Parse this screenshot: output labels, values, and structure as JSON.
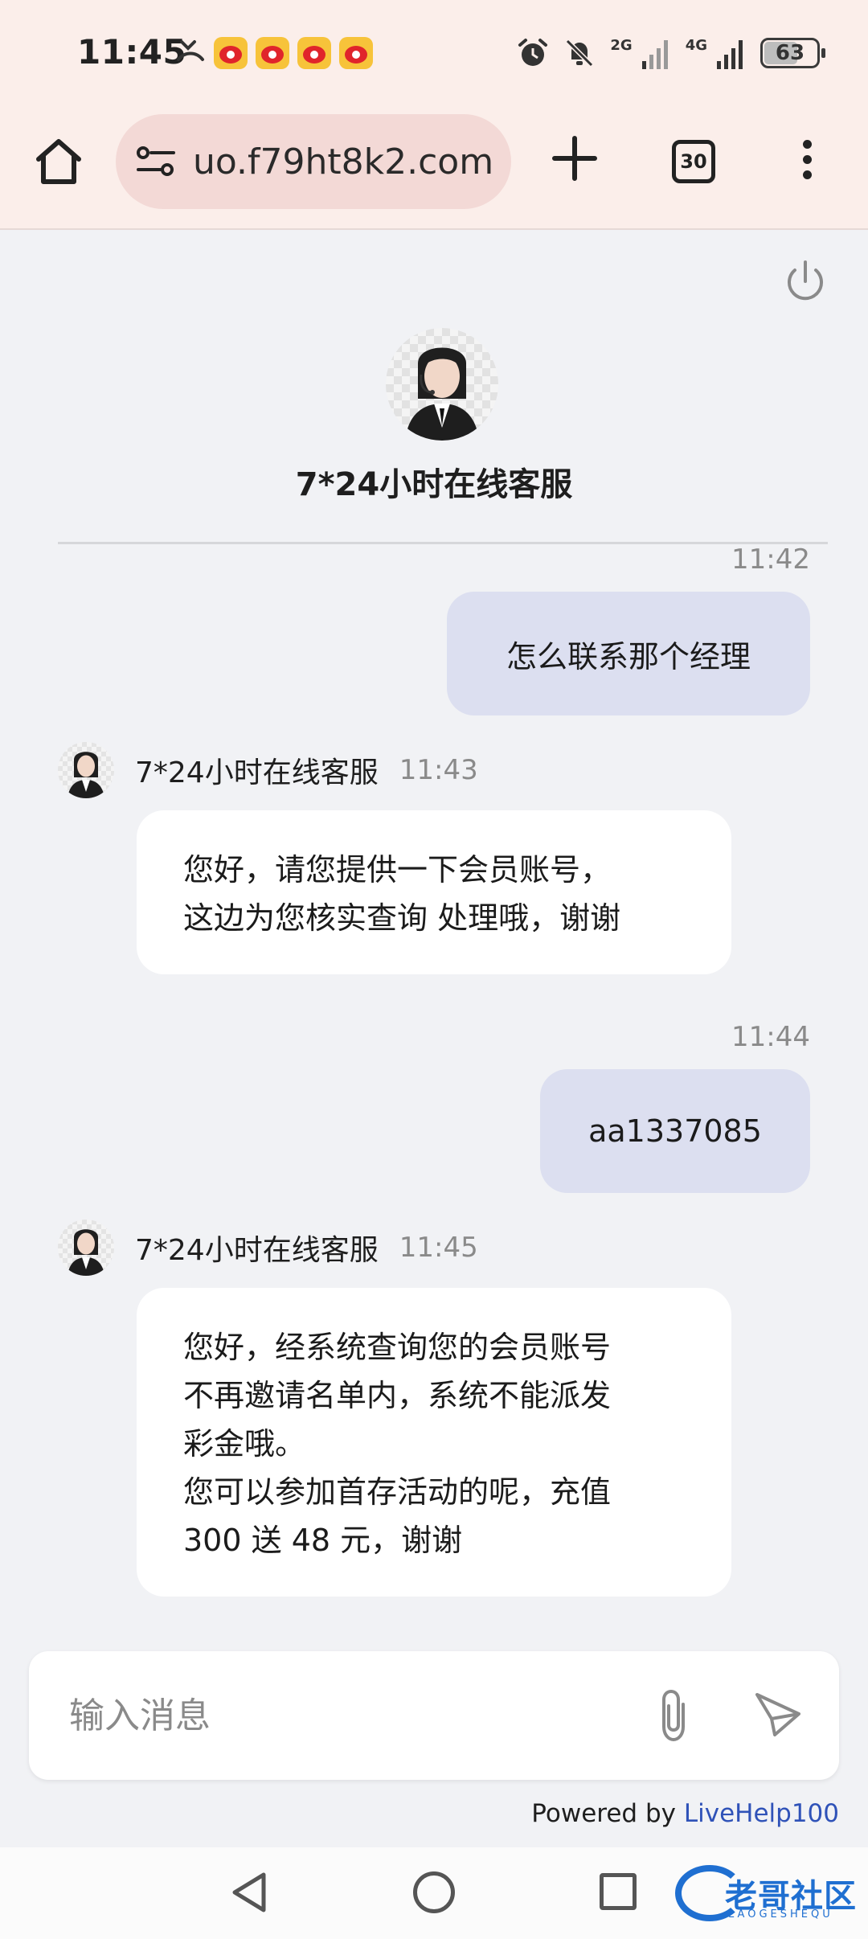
{
  "status_bar": {
    "time": "11:45",
    "network_1": "2G",
    "network_2": "4G",
    "battery_level": "63",
    "icons": [
      "missed-call-icon",
      "weibo-icon",
      "weibo-icon",
      "weibo-icon",
      "weibo-icon",
      "alarm-icon",
      "mute-icon",
      "signal-icon",
      "signal-icon",
      "battery-icon"
    ]
  },
  "browser": {
    "url": "uo.f79ht8k2.com",
    "tab_count": "30",
    "icons": [
      "home-icon",
      "site-settings-icon",
      "new-tab-icon",
      "tabs-icon",
      "more-menu-icon"
    ]
  },
  "chat": {
    "header": {
      "agent_name": "7*24小时在线客服"
    },
    "messages": [
      {
        "role": "user",
        "time": "11:42",
        "lines": [
          "怎么联系那个经理"
        ]
      },
      {
        "role": "agent",
        "name": "7*24小时在线客服",
        "time": "11:43",
        "lines": [
          "您好，请您提供一下会员账号，",
          "这边为您核实查询 处理哦，谢谢"
        ]
      },
      {
        "role": "user",
        "time": "11:44",
        "lines": [
          "aa1337085"
        ]
      },
      {
        "role": "agent",
        "name": "7*24小时在线客服",
        "time": "11:45",
        "lines": [
          "您好，经系统查询您的会员账号",
          "不再邀请名单内，系统不能派发",
          "彩金哦。",
          "您可以参加首存活动的呢，充值",
          "300 送 48 元，谢谢"
        ]
      }
    ],
    "input": {
      "placeholder": "输入消息"
    },
    "powered_by": "Powered by",
    "brand": "LiveHelp100"
  },
  "watermark": {
    "text": "老哥社区",
    "sub": "LAOGESHEQU"
  },
  "colors": {
    "status_bar_bg": "#fbeeea",
    "url_pill_bg": "#f3d9d6",
    "chat_bg": "#f1f2f5",
    "user_bubble": "#dcdff0",
    "agent_bubble": "#ffffff",
    "brand_link": "#2f52b8"
  }
}
